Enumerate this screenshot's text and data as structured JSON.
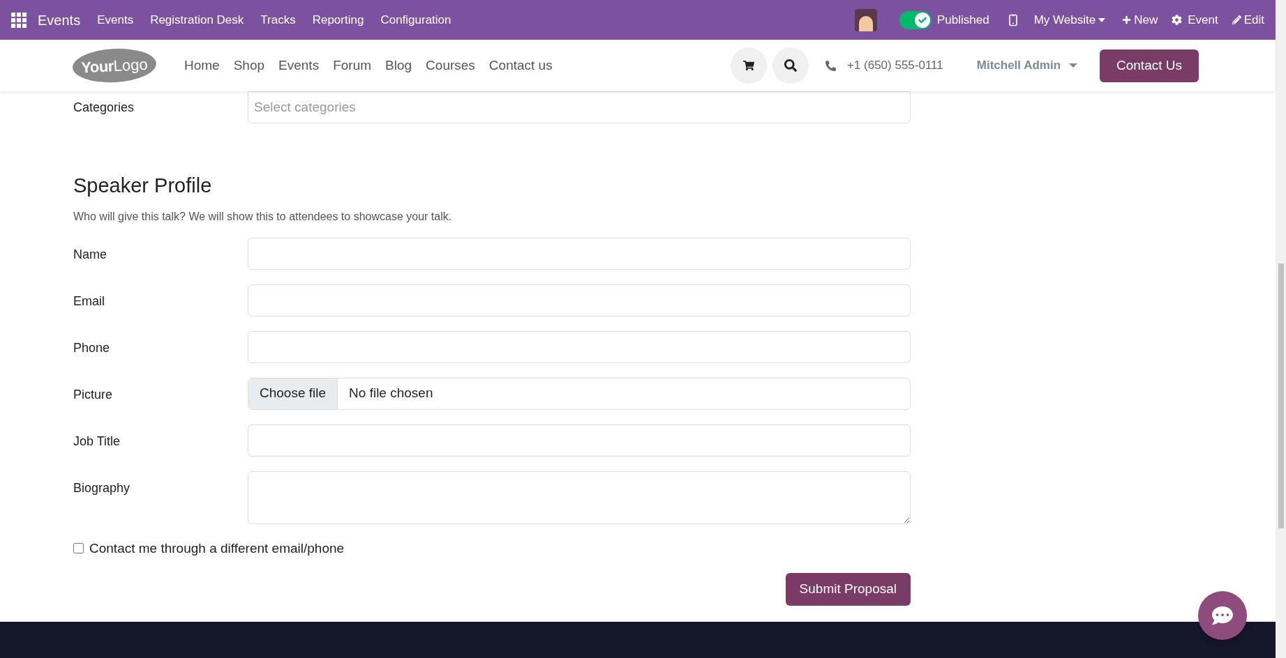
{
  "app_bar": {
    "app_name": "Events",
    "menu": [
      "Events",
      "Registration Desk",
      "Tracks",
      "Reporting",
      "Configuration"
    ],
    "published": {
      "label": "Published",
      "on": true
    },
    "website": "My Website",
    "new": "New",
    "event": "Event",
    "edit": "Edit"
  },
  "site_nav": {
    "logo": {
      "bold": "Your",
      "light": "Logo"
    },
    "links": [
      "Home",
      "Shop",
      "Events",
      "Forum",
      "Blog",
      "Courses",
      "Contact us"
    ],
    "phone": "+1 (650) 555-0111",
    "user": "Mitchell Admin",
    "cta": "Contact Us"
  },
  "categories": {
    "label": "Categories",
    "placeholder": "Select categories"
  },
  "section": {
    "title": "Speaker Profile",
    "subtitle": "Who will give this talk? We will show this to attendees to showcase your talk."
  },
  "fields": [
    {
      "label": "Name",
      "kind": "text"
    },
    {
      "label": "Email",
      "kind": "text"
    },
    {
      "label": "Phone",
      "kind": "text"
    },
    {
      "label": "Picture",
      "kind": "file",
      "button": "Choose file",
      "value": "No file chosen"
    },
    {
      "label": "Job Title",
      "kind": "text"
    },
    {
      "label": "Biography",
      "kind": "textarea"
    }
  ],
  "contact_option": {
    "label": "Contact me through a different email/phone",
    "checked": false
  },
  "submit": "Submit Proposal"
}
